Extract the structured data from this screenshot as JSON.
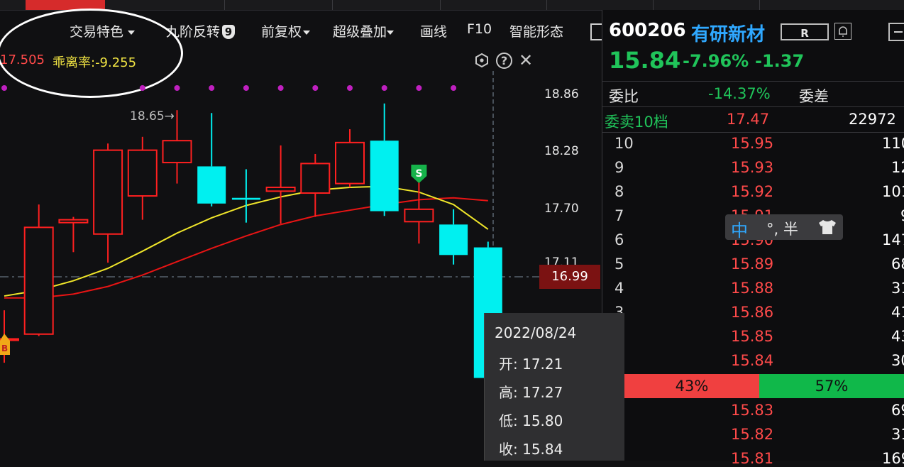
{
  "toolbar": {
    "trade_feature": "交易特色",
    "nine_turn": "九阶反转",
    "nine_badge": "9",
    "pre_adjust": "前复权",
    "super_overlay": "超级叠加",
    "draw_line": "画线",
    "f10": "F10",
    "smart_pattern": "智能形态"
  },
  "indicator": {
    "value1": "17.505",
    "bias_label": "乖离率:-9.255"
  },
  "chart": {
    "marker_label": "18.65→",
    "y_ticks": [
      "18.86",
      "18.28",
      "17.70",
      "17.11"
    ],
    "current_price_tag": "16.99",
    "s_signal": "S",
    "b_signal": "B",
    "colors": {
      "up": "#ff2020",
      "down": "#00f0f0",
      "ma5": "#f0e62a",
      "ma10": "#e81414"
    }
  },
  "chart_data": {
    "type": "candlestick",
    "title": "",
    "ylim": [
      15.8,
      19.1
    ],
    "candles": [
      {
        "o": 16.25,
        "h": 16.55,
        "l": 16.0,
        "c": 16.25
      },
      {
        "o": 16.3,
        "h": 17.66,
        "l": 16.28,
        "c": 17.42
      },
      {
        "o": 17.47,
        "h": 17.53,
        "l": 17.16,
        "c": 17.5
      },
      {
        "o": 17.35,
        "h": 18.3,
        "l": 17.05,
        "c": 18.23
      },
      {
        "o": 17.75,
        "h": 18.37,
        "l": 17.5,
        "c": 18.23
      },
      {
        "o": 18.1,
        "h": 18.65,
        "l": 17.88,
        "c": 18.33
      },
      {
        "o": 18.06,
        "h": 18.62,
        "l": 17.64,
        "c": 17.67
      },
      {
        "o": 17.73,
        "h": 18.03,
        "l": 17.47,
        "c": 17.71
      },
      {
        "o": 17.8,
        "h": 18.28,
        "l": 17.46,
        "c": 17.84
      },
      {
        "o": 17.78,
        "h": 18.19,
        "l": 17.53,
        "c": 18.09
      },
      {
        "o": 17.88,
        "h": 18.45,
        "l": 17.84,
        "c": 18.31
      },
      {
        "o": 18.33,
        "h": 18.72,
        "l": 17.54,
        "c": 17.59
      },
      {
        "o": 17.48,
        "h": 17.94,
        "l": 17.25,
        "c": 17.61
      },
      {
        "o": 17.45,
        "h": 17.61,
        "l": 17.03,
        "c": 17.13
      },
      {
        "o": 17.21,
        "h": 17.27,
        "l": 15.8,
        "c": 15.84
      }
    ],
    "ma5": [
      16.7,
      16.76,
      16.86,
      16.99,
      17.17,
      17.36,
      17.52,
      17.65,
      17.74,
      17.81,
      17.84,
      17.85,
      17.79,
      17.66,
      17.4
    ],
    "ma10": [
      16.68,
      16.68,
      16.72,
      16.8,
      16.92,
      17.06,
      17.2,
      17.33,
      17.45,
      17.54,
      17.6,
      17.66,
      17.71,
      17.73,
      17.7
    ]
  },
  "quote": {
    "code": "600206",
    "name": "有研新材",
    "r_label": "R",
    "last": "15.84",
    "pct": "-7.96%",
    "chg": "-1.37",
    "weibi_label": "委比",
    "weibi": "-14.37%",
    "weicha_label": "委差",
    "sell10_label": "委卖10档",
    "sell10_price": "17.47",
    "sell10_vol": "22972"
  },
  "levels": [
    {
      "n": "10",
      "p": "15.95",
      "v": "110"
    },
    {
      "n": "9",
      "p": "15.93",
      "v": "12"
    },
    {
      "n": "8",
      "p": "15.92",
      "v": "101"
    },
    {
      "n": "7",
      "p": "15.91",
      "v": "9"
    },
    {
      "n": "6",
      "p": "15.90",
      "v": "147"
    },
    {
      "n": "5",
      "p": "15.89",
      "v": "68"
    },
    {
      "n": "4",
      "p": "15.88",
      "v": "31"
    },
    {
      "n": "3",
      "p": "15.86",
      "v": "41"
    },
    {
      "n": "2",
      "p": "15.85",
      "v": "43"
    },
    {
      "n": "1",
      "p": "15.84",
      "v": "30"
    }
  ],
  "ratio": {
    "sell": "43%",
    "buy": "57%"
  },
  "buy_levels": [
    {
      "p": "15.83",
      "v": "69"
    },
    {
      "p": "15.82",
      "v": "31"
    },
    {
      "p": "15.81",
      "v": "169"
    }
  ],
  "ime": {
    "mode": "中",
    "rest": "°, 半"
  },
  "tooltip": {
    "date": "2022/08/24",
    "open_label": "开:",
    "open": "17.21",
    "high_label": "高:",
    "high": "17.27",
    "low_label": "低:",
    "low": "15.80",
    "close_label": "收:",
    "close": "15.84"
  }
}
